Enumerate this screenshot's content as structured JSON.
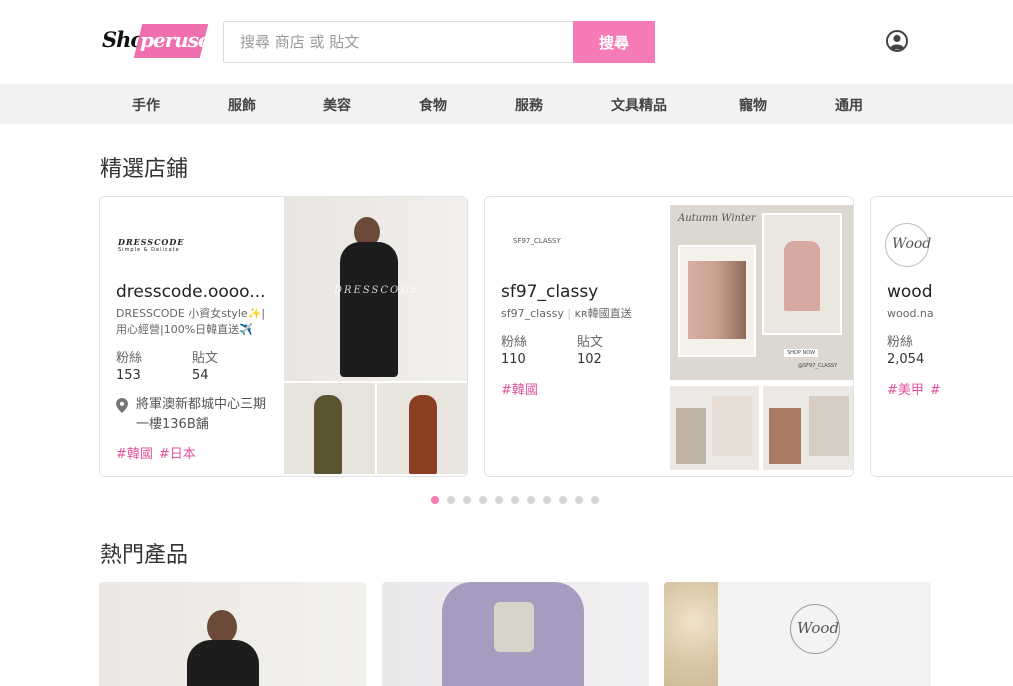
{
  "header": {
    "logo_shop": "Shop",
    "logo_peruse": "peruse",
    "search_placeholder": "搜尋 商店 或 貼文",
    "search_button": "搜尋"
  },
  "nav": {
    "items": [
      "手作",
      "服飾",
      "美容",
      "食物",
      "服務",
      "文具精品",
      "寵物",
      "通用"
    ]
  },
  "featured": {
    "title": "精選店鋪",
    "stores": [
      {
        "logo_text": "DRESSCODE",
        "logo_sub": "Simple & Delicate",
        "name": "dresscode.oooo...",
        "desc": "DRESSCODE 小資女style✨|用心經營|100%日韓直送✈️",
        "followers_label": "粉絲",
        "posts_label": "貼文",
        "followers": "153",
        "posts": "54",
        "location": "將軍澳新都城中心三期一樓136B舖",
        "tags": [
          "#韓國",
          "#日本"
        ],
        "photo_text": "DRESSCODE"
      },
      {
        "logo_text": "SF97_CLASSY",
        "name": "sf97_classy",
        "handle": "sf97_classy",
        "handle_note": "ᴋʀ韓國直送",
        "followers_label": "粉絲",
        "posts_label": "貼文",
        "followers": "110",
        "posts": "102",
        "tags": [
          "#韓國"
        ],
        "photo_title": "Autumn Winter",
        "photo_badge": "SHOP NOW",
        "photo_handle": "@SF97_CLASSY"
      },
      {
        "logo_text": "Wood",
        "name": "wood",
        "handle": "wood.na",
        "followers_label": "粉絲",
        "followers": "2,054",
        "tags": [
          "#美甲",
          "#"
        ]
      }
    ]
  },
  "pagination": {
    "count": 11,
    "active": 0
  },
  "hot": {
    "title": "熱門產品",
    "product_logo": "Wood"
  },
  "colors": {
    "accent": "#f57ab5",
    "tag": "#e0529c",
    "nav_bg": "#f1f2f4"
  },
  "icons": {
    "user": "user-icon",
    "pin": "pin-icon"
  }
}
